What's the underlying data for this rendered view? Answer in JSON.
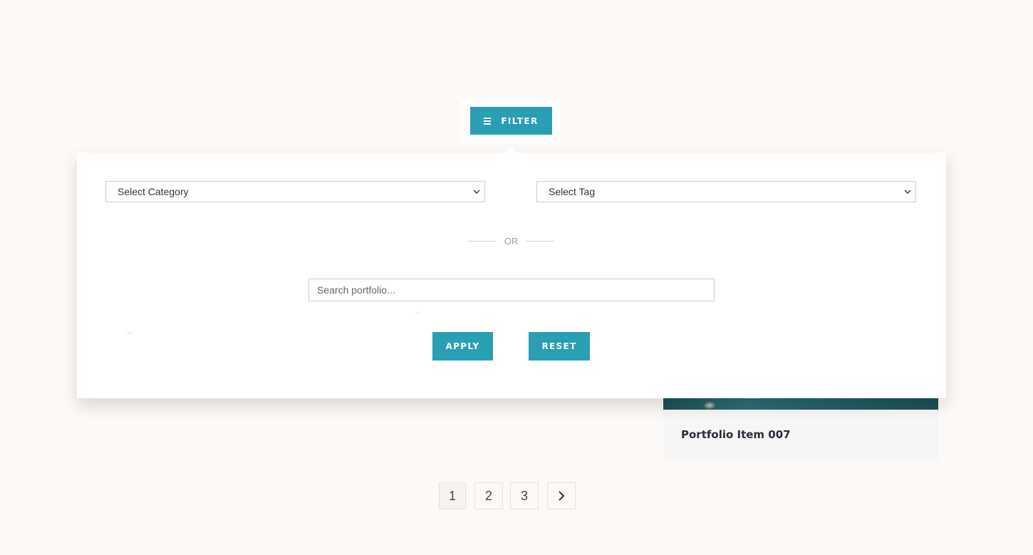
{
  "filter": {
    "toggle_label": "FILTER",
    "icon": "hamburger-menu-icon",
    "accent_color": "#2a9fb3"
  },
  "panel": {
    "category_select": {
      "selected": "Select Category"
    },
    "tag_select": {
      "selected": "Select Tag"
    },
    "separator_text": "OR",
    "search": {
      "placeholder": "Search portfolio...",
      "value": ""
    },
    "apply_label": "APPLY",
    "reset_label": "RESET"
  },
  "card": {
    "title": "Portfolio Item 007"
  },
  "pagination": {
    "pages": [
      "1",
      "2",
      "3"
    ],
    "current": "1",
    "next_icon": "chevron-right-icon"
  }
}
